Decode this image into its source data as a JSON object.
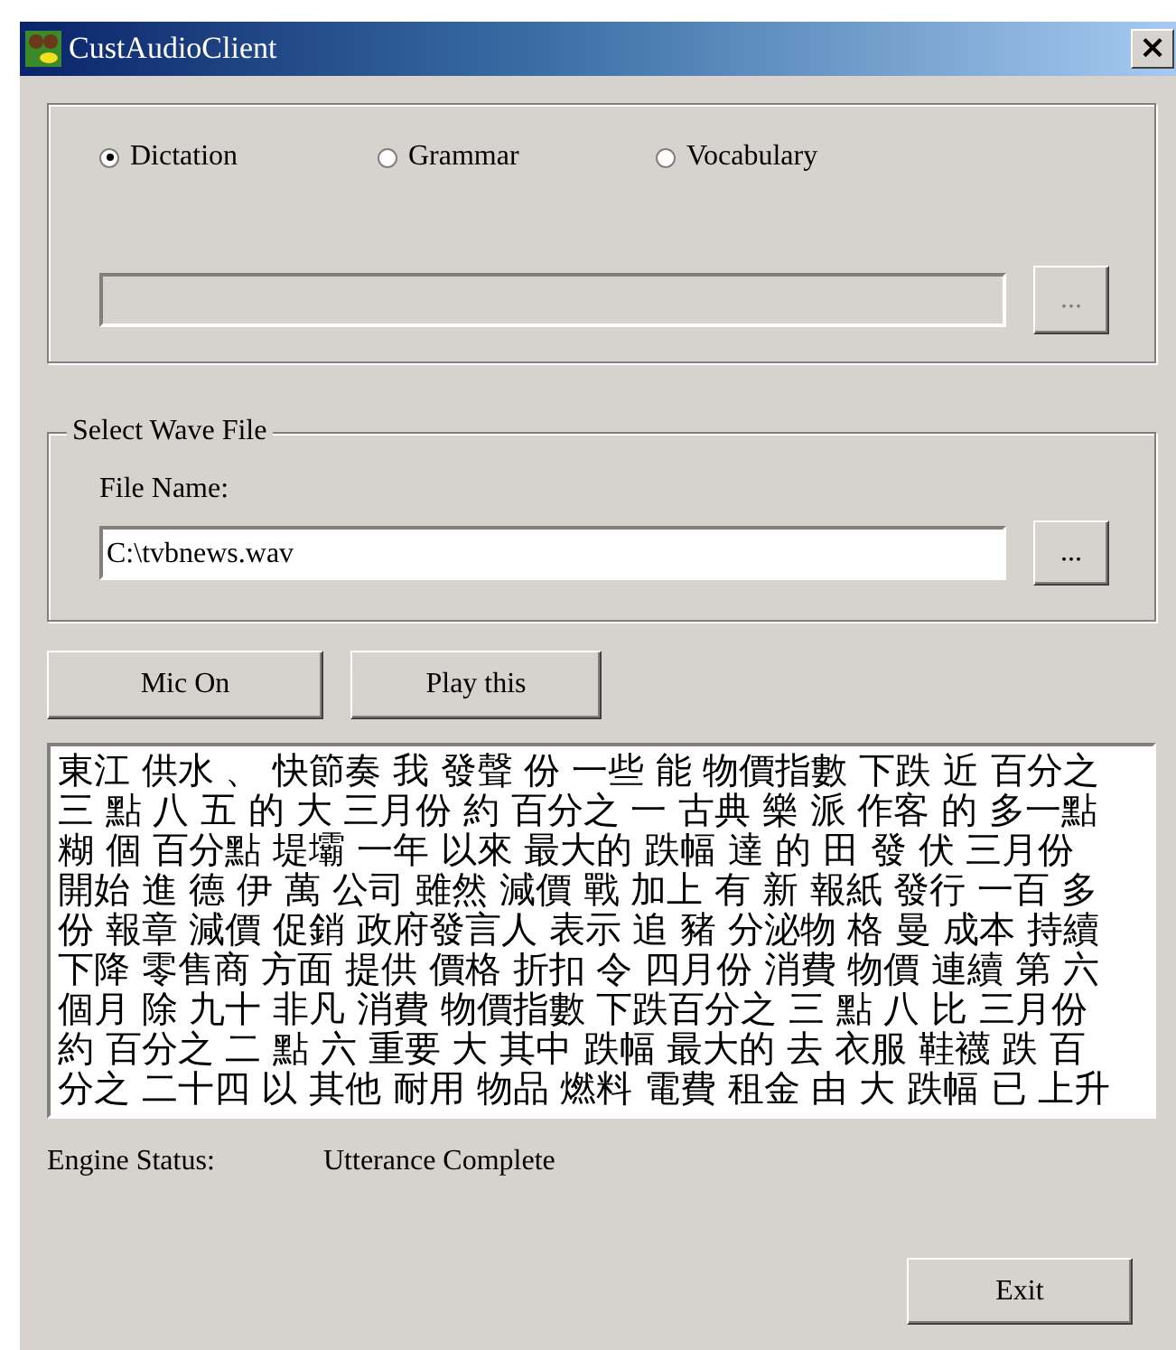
{
  "window": {
    "title": "CustAudioClient",
    "close": "×"
  },
  "modes": [
    {
      "label": "Dictation",
      "selected": true
    },
    {
      "label": "Grammar",
      "selected": false
    },
    {
      "label": "Vocabulary",
      "selected": false
    }
  ],
  "grammar_file": {
    "browse": "..."
  },
  "wave_group": {
    "legend": "Select Wave File",
    "file_label": "File Name:",
    "value": "C:\\tvbnews.wav",
    "browse": "..."
  },
  "buttons": [
    "Mic On",
    "Play this"
  ],
  "transcript_lines": [
    "東江 供水 、 快節奏 我 發聲 份 一些 能 物價指數 下跌 近 百分之",
    "三 點 八 五 的 大 三月份 約 百分之 一 古典 樂 派 作客 的 多一點",
    "糊 個 百分點 堤壩 一年 以來 最大的 跌幅 達 的 田 發 伏 三月份",
    "開始 進 德 伊 萬 公司 雖然 減價 戰 加上 有 新 報紙 發行 一百 多",
    "份 報章 減價 促銷 政府發言人 表示 追 豬 分泌物 格 曼 成本 持續",
    "下降 零售商 方面 提供 價格 折扣 令 四月份 消費 物價 連續 第 六",
    "個月 除 九十 非凡 消費 物價指數 下跌百分之 三 點 八 比 三月份",
    "約 百分之 二 點 六 重要 大 其中 跌幅 最大的 去 衣服 鞋襪 跌 百",
    "分之 二十四 以 其他 耐用 物品 燃料 電費 租金 由 大 跌幅 已 上升"
  ],
  "status": {
    "label": "Engine Status:",
    "value": "Utterance Complete"
  },
  "exit": "Exit"
}
